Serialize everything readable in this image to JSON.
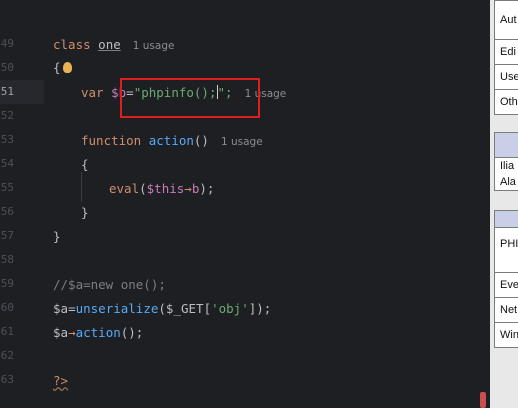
{
  "editor": {
    "current_line": "51",
    "line_numbers": [
      "49",
      "50",
      "51",
      "52",
      "53",
      "54",
      "55",
      "56",
      "57",
      "58",
      "59",
      "60",
      "61",
      "62",
      "63"
    ],
    "lines": {
      "l49_kw": "class",
      "l49_cls": "one",
      "l49_hint": "1 usage",
      "l50": "{",
      "l51_kw": "var",
      "l51_var": "$b",
      "l51_eq": "=",
      "l51_str_a": "\"phpinfo();",
      "l51_str_b": "\";",
      "l51_hint": "1 usage",
      "l53_kw": "function",
      "l53_fn": "action",
      "l53_paren": "()",
      "l53_hint": "1 usage",
      "l54": "{",
      "l55_call": "eval",
      "l55_a": "(",
      "l55_var": "$this",
      "l55_arrow": "→",
      "l55_prop": "b",
      "l55_b": ");",
      "l56": "}",
      "l57": "}",
      "l59": "//$a=new one();",
      "l60_var": "$a",
      "l60_eq": "=",
      "l60_fn": "unserialize",
      "l60_a": "(",
      "l60_get": "$_GET",
      "l60_b": "[",
      "l60_str": "'obj'",
      "l60_c": "]);",
      "l61_var": "$a",
      "l61_arrow": "→",
      "l61_fn": "action",
      "l61_end": "();",
      "l63": "?>"
    }
  },
  "right_panel": {
    "group1": [
      "Aut",
      "Edi",
      "Use",
      "Oth"
    ],
    "group2": [
      "Ilia",
      "Ala"
    ],
    "group3": [
      "PHI",
      "Eve",
      "Net",
      "Win"
    ]
  },
  "colors": {
    "background": "#1e1f22",
    "keyword": "#cf8e6d",
    "variable": "#c77dbb",
    "function": "#56a8f5",
    "string": "#6aab73",
    "annotation_box": "#e01e1e"
  }
}
